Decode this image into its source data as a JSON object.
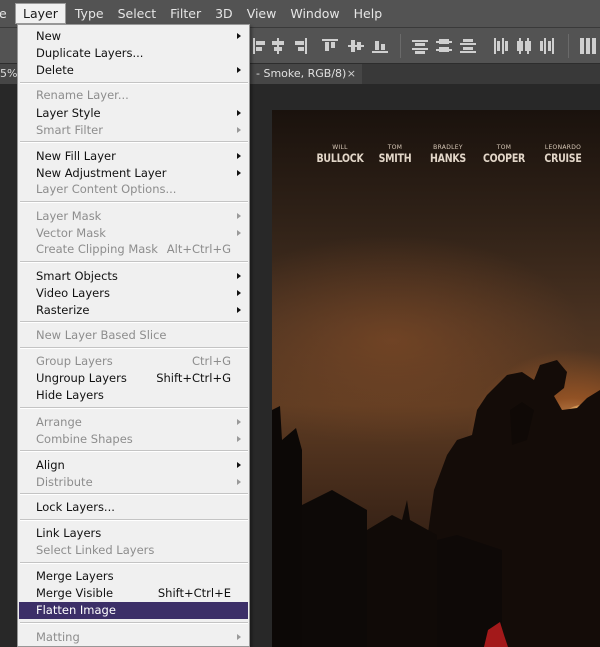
{
  "menubar": {
    "items": [
      {
        "label": "e"
      },
      {
        "label": "Layer"
      },
      {
        "label": "Type"
      },
      {
        "label": "Select"
      },
      {
        "label": "Filter"
      },
      {
        "label": "3D"
      },
      {
        "label": "View"
      },
      {
        "label": "Window"
      },
      {
        "label": "Help"
      }
    ],
    "active": "Layer"
  },
  "tabs": {
    "left_label": "5%",
    "doc_label": "- Smoke, RGB/8)",
    "close_glyph": "×"
  },
  "layer_menu": {
    "items": [
      {
        "label": "New",
        "submenu": true
      },
      {
        "label": "Duplicate Layers..."
      },
      {
        "label": "Delete",
        "submenu": true
      },
      {
        "label": "Rename Layer...",
        "disabled": true
      },
      {
        "label": "Layer Style",
        "submenu": true
      },
      {
        "label": "Smart Filter",
        "disabled": true,
        "submenu": true
      },
      {
        "label": "New Fill Layer",
        "submenu": true
      },
      {
        "label": "New Adjustment Layer",
        "submenu": true
      },
      {
        "label": "Layer Content Options...",
        "disabled": true
      },
      {
        "label": "Layer Mask",
        "disabled": true,
        "submenu": true
      },
      {
        "label": "Vector Mask",
        "disabled": true,
        "submenu": true
      },
      {
        "label": "Create Clipping Mask",
        "disabled": true,
        "shortcut": "Alt+Ctrl+G"
      },
      {
        "label": "Smart Objects",
        "submenu": true
      },
      {
        "label": "Video Layers",
        "submenu": true
      },
      {
        "label": "Rasterize",
        "submenu": true
      },
      {
        "label": "New Layer Based Slice",
        "disabled": true
      },
      {
        "label": "Group Layers",
        "disabled": true,
        "shortcut": "Ctrl+G"
      },
      {
        "label": "Ungroup Layers",
        "shortcut": "Shift+Ctrl+G"
      },
      {
        "label": "Hide Layers"
      },
      {
        "label": "Arrange",
        "disabled": true,
        "submenu": true
      },
      {
        "label": "Combine Shapes",
        "disabled": true,
        "submenu": true
      },
      {
        "label": "Align",
        "submenu": true
      },
      {
        "label": "Distribute",
        "disabled": true,
        "submenu": true
      },
      {
        "label": "Lock Layers..."
      },
      {
        "label": "Link Layers"
      },
      {
        "label": "Select Linked Layers",
        "disabled": true
      },
      {
        "label": "Merge Layers"
      },
      {
        "label": "Merge Visible",
        "shortcut": "Shift+Ctrl+E"
      },
      {
        "label": "Flatten Image",
        "highlighted": true
      },
      {
        "label": "Matting",
        "disabled": true,
        "submenu": true
      }
    ]
  },
  "poster": {
    "actors": [
      {
        "first": "WILL",
        "last": "BULLOCK"
      },
      {
        "first": "TOM",
        "last": "SMITH"
      },
      {
        "first": "BRADLEY",
        "last": "HANKS"
      },
      {
        "first": "TOM",
        "last": "COOPER"
      },
      {
        "first": "LEONARDO",
        "last": "CRUISE"
      }
    ]
  },
  "colors": {
    "menu_highlight": "#3c2f68",
    "menu_background": "#f0f0f0",
    "chrome": "#535353"
  }
}
